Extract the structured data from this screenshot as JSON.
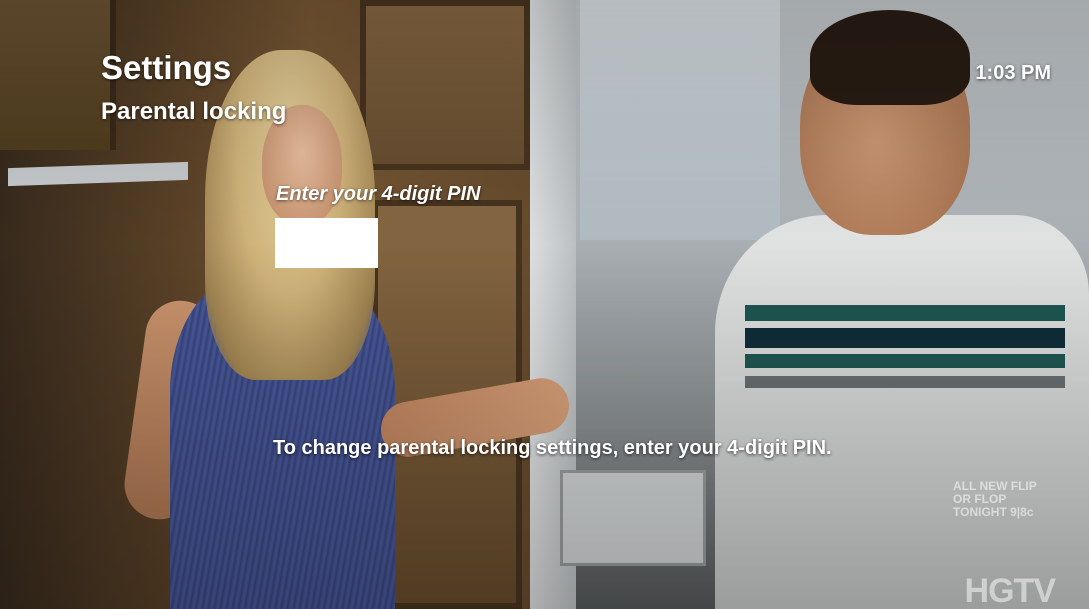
{
  "header": {
    "title": "Settings",
    "subtitle": "Parental locking",
    "clock": "1:03 PM"
  },
  "pin": {
    "prompt": "Enter your 4-digit PIN",
    "value": "",
    "placeholder": ""
  },
  "instructions": "To change parental locking settings, enter your 4-digit PIN.",
  "background": {
    "promo_text": "ALL NEW FLIP OR FLOP TONIGHT 9|8c",
    "network_logo": "HGTV"
  },
  "colors": {
    "text": "#ffffff",
    "pin_box": "#ffffff"
  }
}
